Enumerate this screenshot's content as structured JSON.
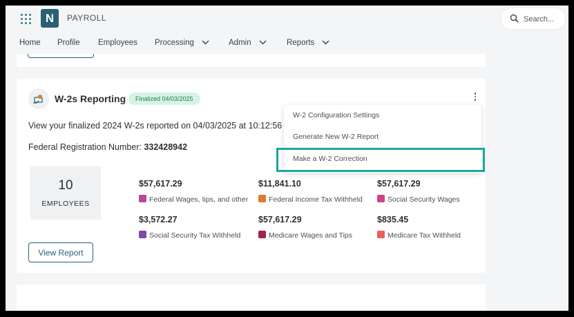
{
  "app": {
    "logo_letter": "N",
    "name": "PAYROLL"
  },
  "search": {
    "placeholder": "Search..."
  },
  "nav": {
    "items": [
      {
        "label": "Home"
      },
      {
        "label": "Profile"
      },
      {
        "label": "Employees"
      },
      {
        "label": "Processing"
      },
      {
        "label": "Admin"
      },
      {
        "label": "Reports"
      }
    ]
  },
  "card": {
    "title": "W-2s Reporting",
    "badge": "Finalized 04/03/2025",
    "description": "View your finalized 2024 W-2s reported on 04/03/2025 at 10:12:56",
    "fed_reg_label": "Federal Registration Number:",
    "fed_reg_value": "332428942",
    "employees": {
      "count": "10",
      "label": "EMPLOYEES"
    },
    "stats": [
      {
        "amount": "$57,617.29",
        "label": "Federal Wages, tips, and other",
        "color": "#b64a99"
      },
      {
        "amount": "$11,841.10",
        "label": "Federal Income Tax Withheld",
        "color": "#e07a2e"
      },
      {
        "amount": "$57,617.29",
        "label": "Social Security Wages",
        "color": "#c9448a"
      },
      {
        "amount": "$3,572.27",
        "label": "Social Security Tax Withheld",
        "color": "#7b4aa8"
      },
      {
        "amount": "$57,617.29",
        "label": "Medicare Wages and Tips",
        "color": "#a3224d"
      },
      {
        "amount": "$835.45",
        "label": "Medicare Tax Withheld",
        "color": "#e8605a"
      }
    ],
    "view_button": "View Report"
  },
  "menu": {
    "items": [
      {
        "label": "W-2 Configuration Settings"
      },
      {
        "label": "Generate New W-2 Report"
      },
      {
        "label": "Make a W-2 Correction"
      }
    ]
  },
  "colors": {
    "brand": "#2a6073",
    "accent_highlight": "#1aa89a",
    "badge_bg": "#d6f3e4",
    "badge_text": "#1e7a4d"
  }
}
